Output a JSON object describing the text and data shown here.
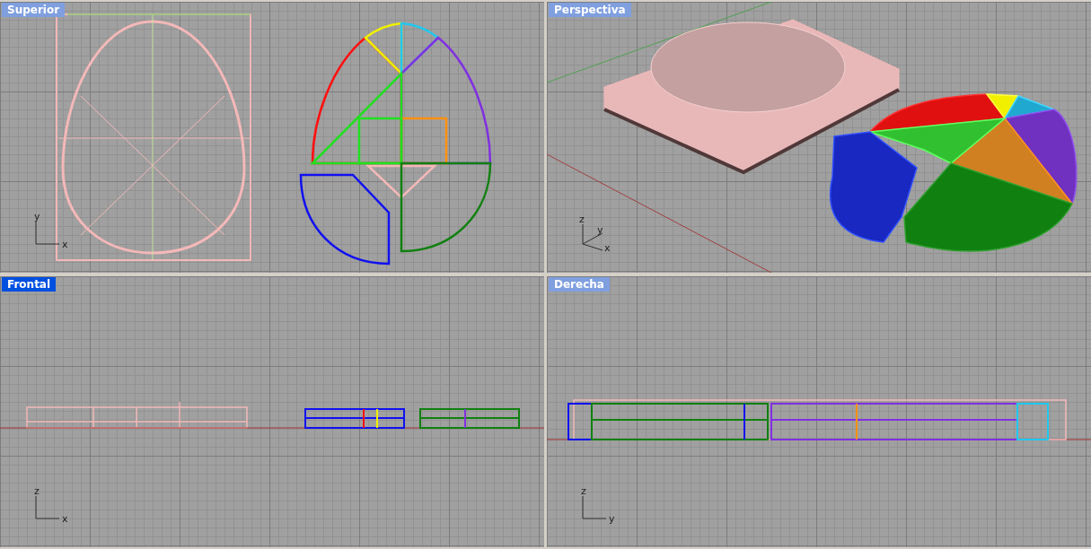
{
  "viewports": [
    {
      "title": "Superior",
      "selected": false,
      "kind": "top",
      "axes": [
        "y",
        "x"
      ]
    },
    {
      "title": "Perspectiva",
      "selected": false,
      "kind": "perspective",
      "axes": [
        "z",
        "y",
        "x"
      ]
    },
    {
      "title": "Frontal",
      "selected": true,
      "kind": "front",
      "axes": [
        "z",
        "x"
      ]
    },
    {
      "title": "Derecha",
      "selected": false,
      "kind": "right",
      "axes": [
        "z",
        "y"
      ]
    }
  ]
}
